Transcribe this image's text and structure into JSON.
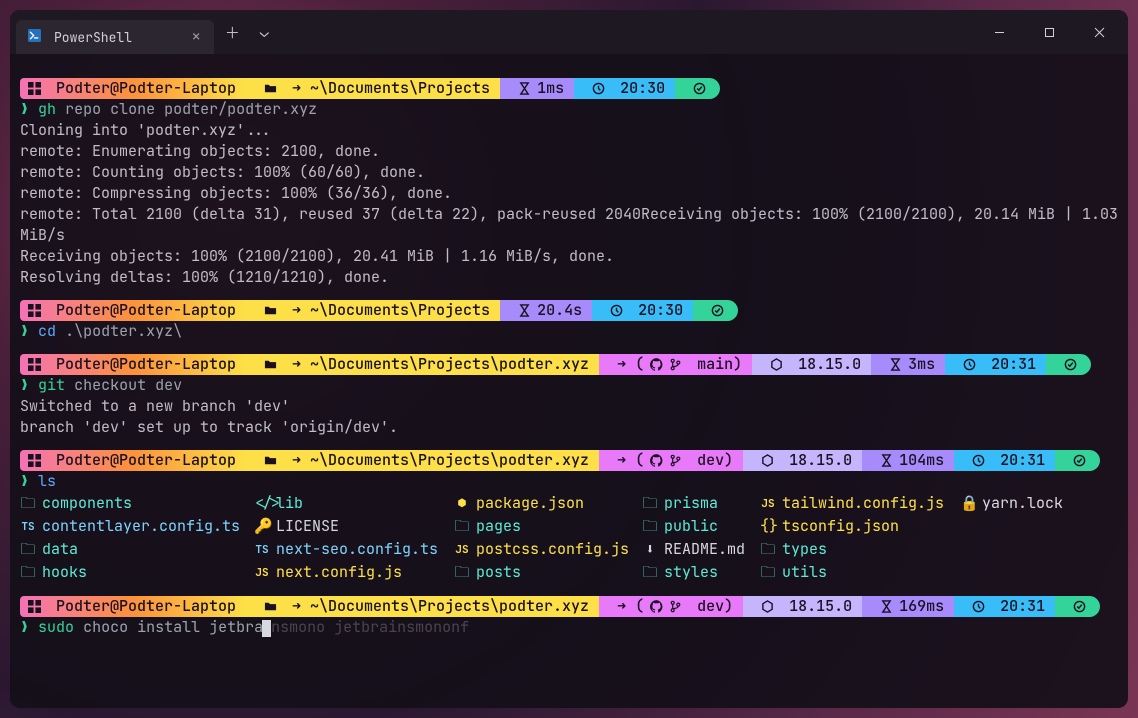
{
  "window": {
    "tab_title": "PowerShell"
  },
  "blocks": [
    {
      "prompt": {
        "user": "Podter@Podter-Laptop",
        "path": "~\\Documents\\Projects",
        "git": null,
        "node": null,
        "dur": "1ms",
        "time": "20:30"
      },
      "cmd": {
        "main": "gh",
        "rest": "repo clone podter/podter.xyz",
        "style": "git"
      },
      "output": [
        "Cloning into 'podter.xyz'...",
        "remote: Enumerating objects: 2100, done.",
        "remote: Counting objects: 100% (60/60), done.",
        "remote: Compressing objects: 100% (36/36), done.",
        "remote: Total 2100 (delta 31), reused 37 (delta 22), pack-reused 2040Receiving objects: 100% (2100/2100), 20.14 MiB | 1.03 MiB/s",
        "Receiving objects: 100% (2100/2100), 20.41 MiB | 1.16 MiB/s, done.",
        "Resolving deltas: 100% (1210/1210), done."
      ]
    },
    {
      "prompt": {
        "user": "Podter@Podter-Laptop",
        "path": "~\\Documents\\Projects",
        "git": null,
        "node": null,
        "dur": "20.4s",
        "time": "20:30"
      },
      "cmd": {
        "main": "cd",
        "rest": ".\\podter.xyz\\",
        "style": "blue"
      },
      "output": []
    },
    {
      "prompt": {
        "user": "Podter@Podter-Laptop",
        "path": "~\\Documents\\Projects\\podter.xyz",
        "git": "main",
        "node": "18.15.0",
        "dur": "3ms",
        "time": "20:31"
      },
      "cmd": {
        "main": "git",
        "rest": "checkout dev",
        "style": "git"
      },
      "output": [
        "Switched to a new branch 'dev'",
        "branch 'dev' set up to track 'origin/dev'."
      ]
    },
    {
      "prompt": {
        "user": "Podter@Podter-Laptop",
        "path": "~\\Documents\\Projects\\podter.xyz",
        "git": "dev",
        "node": "18.15.0",
        "dur": "104ms",
        "time": "20:31"
      },
      "cmd": {
        "main": "ls",
        "rest": "",
        "style": "blue"
      },
      "ls": [
        {
          "icon": "folder",
          "cls": "dir",
          "name": "components"
        },
        {
          "icon": "code",
          "cls": "dir",
          "name": "lib"
        },
        {
          "icon": "pkg",
          "cls": "file-json",
          "name": "package.json"
        },
        {
          "icon": "folder",
          "cls": "dir",
          "name": "prisma"
        },
        {
          "icon": "js",
          "cls": "file-js",
          "name": "tailwind.config.js"
        },
        {
          "icon": "lock",
          "cls": "file-lock",
          "name": "yarn.lock"
        },
        {
          "icon": "ts",
          "cls": "file-ts",
          "name": "contentlayer.config.ts"
        },
        {
          "icon": "key",
          "cls": "file-plain",
          "name": "LICENSE"
        },
        {
          "icon": "folder",
          "cls": "dir",
          "name": "pages"
        },
        {
          "icon": "folder",
          "cls": "dir",
          "name": "public"
        },
        {
          "icon": "braces",
          "cls": "file-json",
          "name": "tsconfig.json"
        },
        {
          "icon": "",
          "cls": "",
          "name": ""
        },
        {
          "icon": "folder",
          "cls": "dir",
          "name": "data"
        },
        {
          "icon": "ts",
          "cls": "file-ts",
          "name": "next-seo.config.ts"
        },
        {
          "icon": "js",
          "cls": "file-js",
          "name": "postcss.config.js"
        },
        {
          "icon": "md",
          "cls": "file-md",
          "name": "README.md"
        },
        {
          "icon": "folder",
          "cls": "dir",
          "name": "types"
        },
        {
          "icon": "",
          "cls": "",
          "name": ""
        },
        {
          "icon": "folder",
          "cls": "dir",
          "name": "hooks"
        },
        {
          "icon": "js",
          "cls": "file-js",
          "name": "next.config.js"
        },
        {
          "icon": "folder",
          "cls": "dir",
          "name": "posts"
        },
        {
          "icon": "folder",
          "cls": "dir",
          "name": "styles"
        },
        {
          "icon": "folder",
          "cls": "dir",
          "name": "utils"
        },
        {
          "icon": "",
          "cls": "",
          "name": ""
        }
      ]
    },
    {
      "prompt": {
        "user": "Podter@Podter-Laptop",
        "path": "~\\Documents\\Projects\\podter.xyz",
        "git": "dev",
        "node": "18.15.0",
        "dur": "169ms",
        "time": "20:31"
      },
      "input": {
        "typed_main": "sudo",
        "typed_rest": "choco install jetbra",
        "cursor": "i",
        "ghost": "nsmono jetbrainsmononf"
      }
    }
  ],
  "icons": {
    "windows": "⊞",
    "folder": "📁",
    "arrow": "➜",
    "hourglass": "⏳",
    "clock": "🕐",
    "check": "✔",
    "github": "",
    "branch": "",
    "hex": "⬢"
  }
}
